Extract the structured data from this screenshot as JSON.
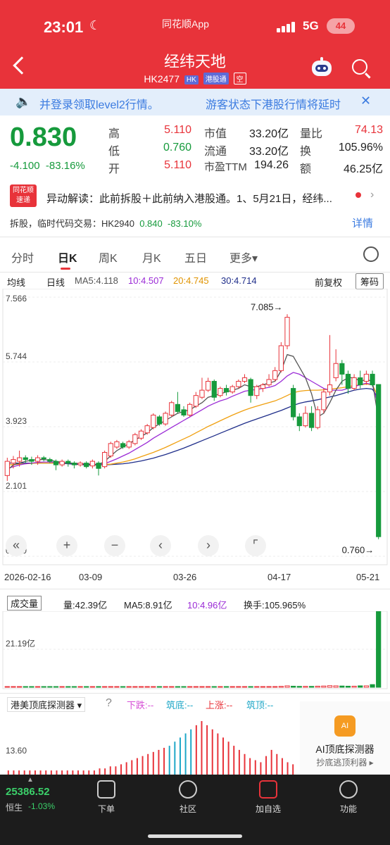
{
  "status": {
    "time": "23:01",
    "app_label": "同花顺App",
    "network": "5G",
    "battery": "44"
  },
  "header": {
    "name": "经纬天地",
    "code": "HK2477",
    "tag_market": "HK",
    "tag_connect": "港股通",
    "tag_short": "空"
  },
  "notice": {
    "left": "并登录领取level2行情。",
    "right": "游客状态下港股行情将延时"
  },
  "quote": {
    "price": "0.830",
    "change": "-4.100",
    "change_pct": "-83.16%",
    "high_label": "高",
    "high": "5.110",
    "low_label": "低",
    "low": "0.760",
    "open_label": "开",
    "open": "5.110",
    "mcap_label": "市值",
    "mcap": "33.20亿",
    "float_label": "流通",
    "float": "33.20亿",
    "pe_label": "市盈TTM",
    "pe": "194.26",
    "vr_label": "量比",
    "vr": "74.13",
    "turnover_label": "换",
    "turnover": "105.96%",
    "amount_label": "额",
    "amount": "46.25亿"
  },
  "news": {
    "logo_top": "同花顺",
    "logo_bottom": "速递",
    "text": "异动解读：此前拆股＋此前纳入港股通。1、5月21日，经纬...",
    "split_prefix": "拆股，临时代码交易：HK2940",
    "split_price": "0.840",
    "split_pct": "-83.10%",
    "detail": "详情"
  },
  "tabs": [
    "分时",
    "日K",
    "周K",
    "月K",
    "五日",
    "更多▾"
  ],
  "ma": {
    "type": "均线",
    "period": "日线",
    "ma5": "MA5:4.118",
    "ma10": "10:4.507",
    "ma20": "20:4.745",
    "ma30": "30:4.714",
    "adjust": "前复权",
    "chips": "筹码",
    "colors": {
      "ma5": "#555555",
      "ma10": "#9b2bd6",
      "ma20": "#f0a010",
      "ma30": "#1f2e8a"
    }
  },
  "chart_data": {
    "type": "candlestick",
    "y_ticks": [
      "7.566",
      "5.744",
      "3.923",
      "2.101",
      "0.279"
    ],
    "ylim": [
      0.279,
      7.566
    ],
    "max_label": "7.085→",
    "min_label": "0.760→",
    "x_labels": [
      "2026-02-16",
      "03-09",
      "03-26",
      "04-17",
      "05-21"
    ],
    "candles": [
      [
        2.55,
        2.95,
        2.4,
        3.05
      ],
      [
        2.9,
        3.0,
        2.75,
        3.1
      ],
      [
        2.95,
        3.05,
        2.8,
        3.25
      ],
      [
        3.05,
        3.0,
        2.9,
        3.12
      ],
      [
        3.0,
        2.95,
        2.85,
        3.08
      ],
      [
        2.95,
        3.05,
        2.85,
        3.12
      ],
      [
        3.05,
        3.02,
        2.95,
        3.1
      ],
      [
        3.0,
        2.95,
        2.9,
        3.05
      ],
      [
        2.95,
        2.85,
        2.7,
        3.0
      ],
      [
        2.85,
        2.95,
        2.8,
        3.0
      ],
      [
        2.95,
        2.9,
        2.8,
        3.0
      ],
      [
        2.9,
        2.85,
        2.75,
        2.95
      ],
      [
        2.85,
        2.9,
        2.8,
        2.95
      ],
      [
        2.9,
        2.8,
        2.75,
        2.95
      ],
      [
        2.82,
        2.95,
        2.75,
        3.0
      ],
      [
        2.9,
        2.75,
        2.55,
        2.95
      ],
      [
        2.8,
        3.2,
        2.75,
        3.25
      ],
      [
        3.1,
        3.45,
        3.05,
        3.5
      ],
      [
        3.35,
        3.5,
        3.3,
        3.55
      ],
      [
        3.45,
        3.35,
        3.3,
        3.5
      ],
      [
        3.35,
        3.5,
        3.3,
        3.55
      ],
      [
        3.45,
        3.7,
        3.4,
        3.75
      ],
      [
        3.6,
        3.8,
        3.55,
        3.85
      ],
      [
        3.75,
        3.95,
        3.7,
        4.0
      ],
      [
        3.9,
        4.25,
        3.85,
        4.3
      ],
      [
        4.2,
        4.0,
        3.95,
        4.25
      ],
      [
        4.0,
        4.3,
        3.95,
        4.35
      ],
      [
        4.25,
        4.6,
        4.2,
        4.65
      ],
      [
        4.55,
        4.35,
        4.3,
        4.9
      ],
      [
        4.4,
        4.25,
        4.2,
        4.5
      ],
      [
        4.25,
        4.55,
        4.2,
        4.6
      ],
      [
        4.5,
        4.8,
        4.45,
        4.9
      ],
      [
        4.75,
        4.95,
        4.7,
        5.3
      ],
      [
        4.95,
        5.2,
        4.9,
        5.3
      ],
      [
        5.2,
        4.75,
        4.65,
        5.25
      ],
      [
        4.8,
        5.0,
        4.75,
        5.05
      ],
      [
        5.0,
        4.9,
        4.8,
        5.1
      ],
      [
        4.9,
        5.05,
        4.85,
        5.1
      ],
      [
        5.05,
        5.2,
        5.0,
        5.25
      ],
      [
        5.2,
        5.3,
        5.15,
        5.4
      ],
      [
        5.25,
        4.8,
        4.6,
        5.3
      ],
      [
        4.8,
        5.05,
        4.7,
        5.1
      ],
      [
        5.0,
        5.1,
        4.9,
        5.15
      ],
      [
        5.1,
        5.25,
        5.05,
        5.4
      ],
      [
        5.25,
        5.5,
        5.2,
        5.6
      ],
      [
        5.5,
        6.2,
        5.45,
        6.3
      ],
      [
        6.2,
        7.0,
        6.1,
        7.085
      ],
      [
        5.0,
        4.2,
        4.1,
        5.1
      ],
      [
        4.2,
        3.95,
        3.8,
        4.3
      ],
      [
        3.95,
        4.3,
        3.9,
        4.5
      ],
      [
        4.3,
        3.9,
        3.8,
        4.5
      ],
      [
        3.9,
        4.4,
        3.85,
        4.5
      ],
      [
        4.4,
        4.9,
        4.3,
        5.0
      ],
      [
        4.9,
        5.1,
        4.8,
        6.5
      ],
      [
        5.3,
        5.7,
        5.2,
        6.1
      ],
      [
        5.7,
        5.4,
        5.1,
        5.8
      ],
      [
        5.4,
        5.0,
        4.85,
        5.5
      ],
      [
        5.0,
        5.3,
        4.95,
        5.4
      ],
      [
        5.3,
        5.1,
        5.0,
        5.5
      ],
      [
        5.2,
        5.4,
        5.1,
        5.5
      ],
      [
        5.4,
        5.1,
        5.05,
        5.5
      ],
      [
        5.11,
        0.83,
        0.76,
        5.11
      ]
    ],
    "ma5": [
      2.7,
      2.85,
      2.9,
      2.95,
      2.98,
      3.0,
      3.0,
      2.98,
      2.95,
      2.92,
      2.9,
      2.9,
      2.88,
      2.87,
      2.86,
      2.85,
      2.95,
      3.1,
      3.25,
      3.35,
      3.45,
      3.55,
      3.65,
      3.75,
      3.9,
      4.0,
      4.1,
      4.2,
      4.3,
      4.35,
      4.4,
      4.5,
      4.6,
      4.75,
      4.8,
      4.85,
      4.9,
      4.95,
      5.0,
      5.1,
      5.05,
      5.05,
      5.1,
      5.15,
      5.2,
      5.5,
      5.95,
      5.9,
      5.6,
      5.3,
      4.85,
      4.2,
      4.3,
      4.6,
      4.95,
      5.2,
      5.3,
      5.3,
      5.2,
      5.25,
      5.2,
      4.118
    ],
    "ma10": [
      2.75,
      2.8,
      2.85,
      2.88,
      2.9,
      2.92,
      2.93,
      2.93,
      2.92,
      2.91,
      2.9,
      2.89,
      2.88,
      2.88,
      2.87,
      2.86,
      2.88,
      2.95,
      3.02,
      3.1,
      3.18,
      3.28,
      3.38,
      3.48,
      3.6,
      3.7,
      3.8,
      3.9,
      4.0,
      4.1,
      4.2,
      4.3,
      4.4,
      4.5,
      4.58,
      4.65,
      4.7,
      4.78,
      4.85,
      4.92,
      4.95,
      4.97,
      5.0,
      5.03,
      5.08,
      5.2,
      5.35,
      5.45,
      5.4,
      5.3,
      5.2,
      5.1,
      5.0,
      4.95,
      4.95,
      4.95,
      5.0,
      5.05,
      5.1,
      5.15,
      5.1,
      4.507
    ],
    "ma20": [
      2.85,
      2.86,
      2.87,
      2.88,
      2.89,
      2.9,
      2.9,
      2.9,
      2.9,
      2.9,
      2.9,
      2.89,
      2.88,
      2.88,
      2.87,
      2.86,
      2.86,
      2.87,
      2.9,
      2.93,
      2.97,
      3.02,
      3.08,
      3.14,
      3.2,
      3.27,
      3.34,
      3.42,
      3.5,
      3.58,
      3.66,
      3.75,
      3.84,
      3.93,
      4.01,
      4.09,
      4.17,
      4.25,
      4.32,
      4.39,
      4.45,
      4.5,
      4.55,
      4.6,
      4.65,
      4.72,
      4.8,
      4.88,
      4.92,
      4.94,
      4.95,
      4.95,
      4.96,
      4.98,
      5.0,
      5.02,
      5.05,
      5.08,
      5.1,
      5.12,
      5.1,
      4.745
    ],
    "ma30": [
      2.9,
      2.9,
      2.9,
      2.9,
      2.9,
      2.9,
      2.9,
      2.9,
      2.9,
      2.89,
      2.88,
      2.87,
      2.86,
      2.85,
      2.85,
      2.85,
      2.85,
      2.86,
      2.87,
      2.88,
      2.9,
      2.93,
      2.96,
      3.0,
      3.04,
      3.09,
      3.14,
      3.2,
      3.26,
      3.32,
      3.39,
      3.46,
      3.53,
      3.6,
      3.67,
      3.74,
      3.81,
      3.88,
      3.95,
      4.02,
      4.08,
      4.14,
      4.2,
      4.26,
      4.32,
      4.38,
      4.45,
      4.52,
      4.58,
      4.62,
      4.65,
      4.68,
      4.72,
      4.76,
      4.8,
      4.85,
      4.9,
      4.95,
      4.98,
      5.0,
      4.98,
      4.714
    ],
    "volume": {
      "label": "成交量",
      "amount": "量:42.39亿",
      "ma5": "MA5:8.91亿",
      "ma10": "10:4.96亿",
      "turnover": "换手:105.965%",
      "axis_label": "21.19亿",
      "ymax": 42.39,
      "values": [
        0.3,
        0.2,
        0.2,
        0.2,
        0.2,
        0.2,
        0.2,
        0.2,
        0.2,
        0.2,
        0.2,
        0.2,
        0.2,
        0.2,
        0.2,
        0.3,
        0.3,
        0.3,
        0.3,
        0.3,
        0.3,
        0.3,
        0.3,
        0.3,
        0.3,
        0.3,
        0.3,
        0.3,
        0.3,
        0.3,
        0.3,
        0.3,
        0.3,
        0.3,
        0.3,
        0.3,
        0.3,
        0.3,
        0.3,
        0.3,
        0.3,
        0.3,
        0.3,
        0.4,
        0.4,
        0.5,
        0.8,
        0.6,
        0.5,
        0.5,
        0.5,
        0.6,
        0.7,
        0.9,
        0.8,
        0.7,
        0.6,
        0.6,
        0.8,
        0.8,
        1.5,
        42.39
      ]
    },
    "detector": {
      "title": "港美顶底探测器",
      "down": "下跌:--",
      "bottom": "筑底:--",
      "up": "上涨:--",
      "top": "筑顶:--",
      "axis_label": "13.60",
      "bars": [
        2,
        2,
        2,
        2,
        2,
        2,
        2,
        2,
        2,
        2,
        2,
        2,
        2,
        2,
        2,
        2,
        2,
        3,
        3,
        4,
        4,
        5,
        6,
        7,
        8,
        9,
        10,
        11,
        12,
        13,
        14,
        16,
        18,
        20,
        22,
        24,
        26,
        24,
        22,
        20,
        18,
        16,
        14,
        12,
        10,
        8,
        7,
        6,
        9,
        12,
        10,
        8,
        6,
        5
      ],
      "cyan_index": [
        30,
        31,
        32,
        33,
        34
      ]
    }
  },
  "controls": [
    "«",
    "+",
    "−",
    "‹",
    "›",
    "⌜"
  ],
  "ai": {
    "icon": "AI",
    "title": "AI顶底探测器",
    "subtitle": "抄底逃顶利器 ▸"
  },
  "bottom_nav": {
    "index_value": "25386.52",
    "index_name": "恒生",
    "index_pct": "-1.03%",
    "items": [
      "下单",
      "社区",
      "加自选",
      "功能"
    ]
  }
}
